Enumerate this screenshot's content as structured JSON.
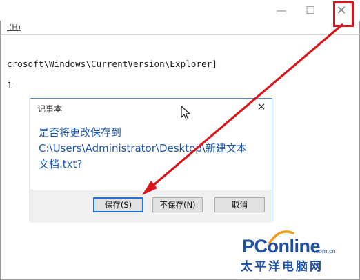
{
  "window": {
    "minimize_icon": "minimize-icon",
    "maximize_icon": "maximize-icon",
    "close_icon": "close-icon",
    "highlight_color": "#d9151c"
  },
  "menubar": {
    "partial_item": "l(H)"
  },
  "editor": {
    "line1": "crosoft\\Windows\\CurrentVersion\\Explorer]",
    "line2": "1"
  },
  "dialog": {
    "title": "记事本",
    "close_icon": "close-icon",
    "message_line1": "是否将更改保存到",
    "message_line2": "C:\\Users\\Administrator\\Desktop\\新建文本",
    "message_line3": "文档.txt?",
    "buttons": {
      "save": "保存(S)",
      "dont_save": "不保存(N)",
      "cancel": "取消"
    }
  },
  "watermark": {
    "brand": "PConline",
    "domain": ".com.cn",
    "cn": "太平洋电脑网"
  },
  "colors": {
    "message": "#1b55b3",
    "arrow": "#d9151c",
    "dialog_border": "#4d8ecf"
  }
}
